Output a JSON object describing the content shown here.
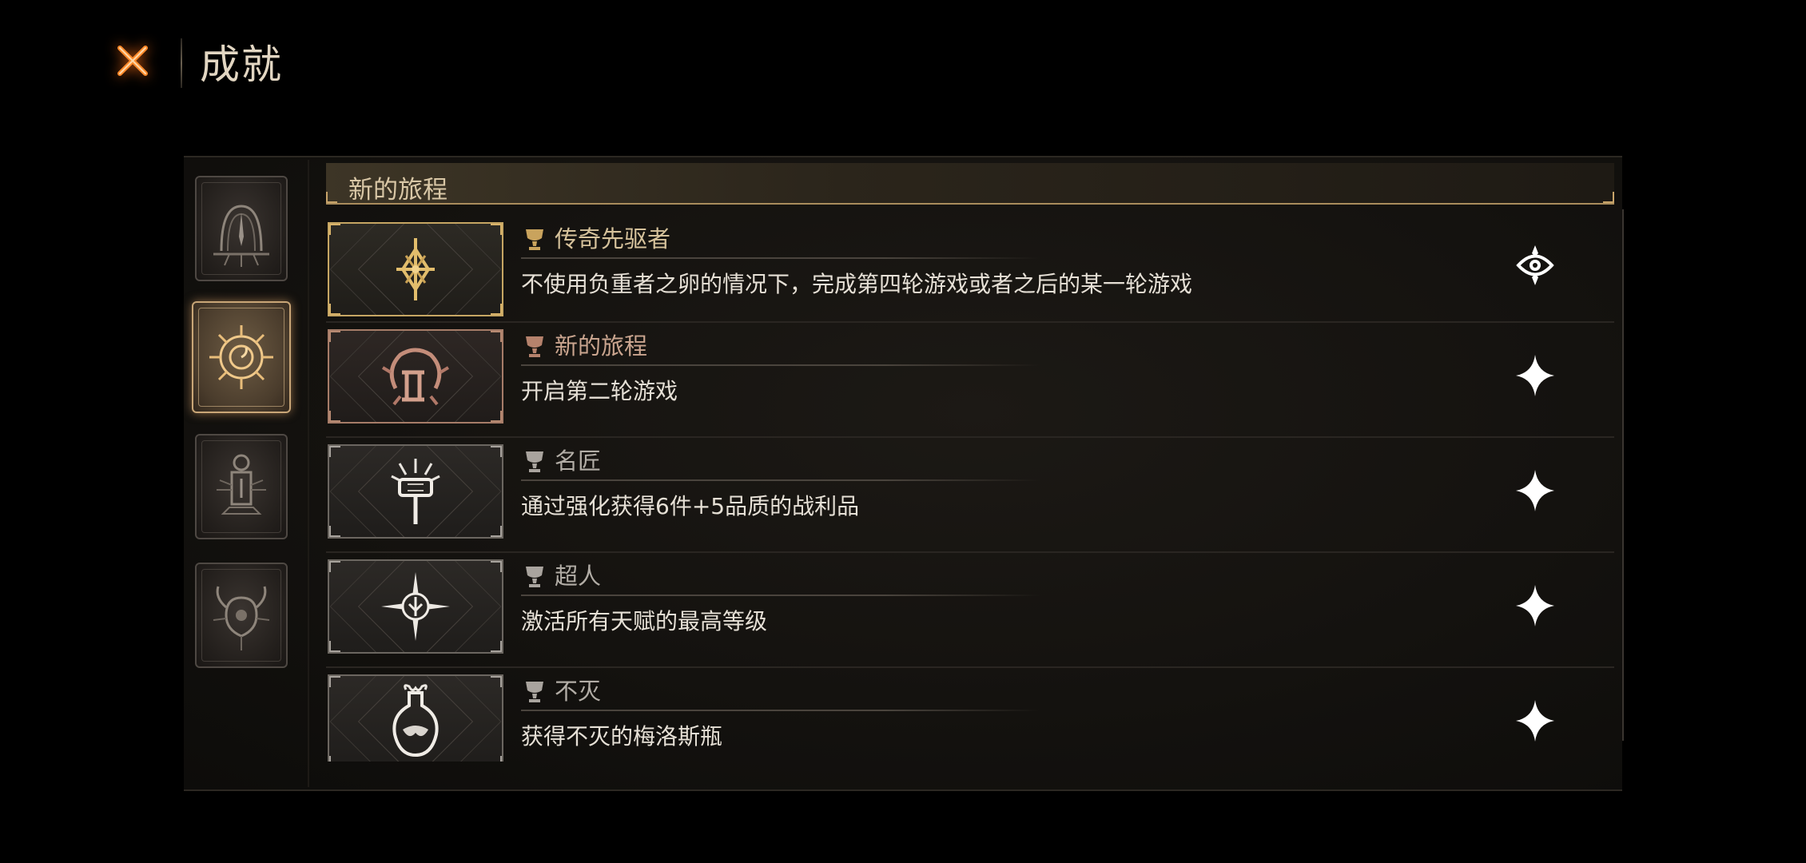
{
  "header": {
    "title": "成就",
    "close_icon": "close-x-icon",
    "accent_color": "#ff7a1a"
  },
  "categories": [
    {
      "icon": "arch-spike-emblem-icon",
      "selected": false
    },
    {
      "icon": "sun-spiral-emblem-icon",
      "selected": true
    },
    {
      "icon": "lantern-emblem-icon",
      "selected": false
    },
    {
      "icon": "horned-skull-emblem-icon",
      "selected": false
    }
  ],
  "section": {
    "title": "新的旅程"
  },
  "achievements": [
    {
      "name": "传奇先驱者",
      "description": "不使用负重者之卵的情况下，完成第四轮游戏或者之后的某一轮游戏",
      "icon": "ornate-cross-emblem-icon",
      "frame": "gold",
      "trophy": "gold",
      "status_icon": "completed-eye-emblem-icon"
    },
    {
      "name": "新的旅程",
      "description": "开启第二轮游戏",
      "icon": "roman-two-emblem-icon",
      "frame": "bronze",
      "trophy": "bronze",
      "status_icon": "sparkle-icon"
    },
    {
      "name": "名匠",
      "description": "通过强化获得6件+5品质的战利品",
      "icon": "hammer-emblem-icon",
      "frame": "silver",
      "trophy": "silver",
      "status_icon": "sparkle-icon"
    },
    {
      "name": "超人",
      "description": "激活所有天赋的最高等级",
      "icon": "star-compass-emblem-icon",
      "frame": "silver",
      "trophy": "silver",
      "status_icon": "sparkle-icon"
    },
    {
      "name": "不灭",
      "description": "获得不灭的梅洛斯瓶",
      "icon": "flask-emblem-icon",
      "frame": "silver",
      "trophy": "silver",
      "status_icon": "sparkle-icon"
    }
  ]
}
